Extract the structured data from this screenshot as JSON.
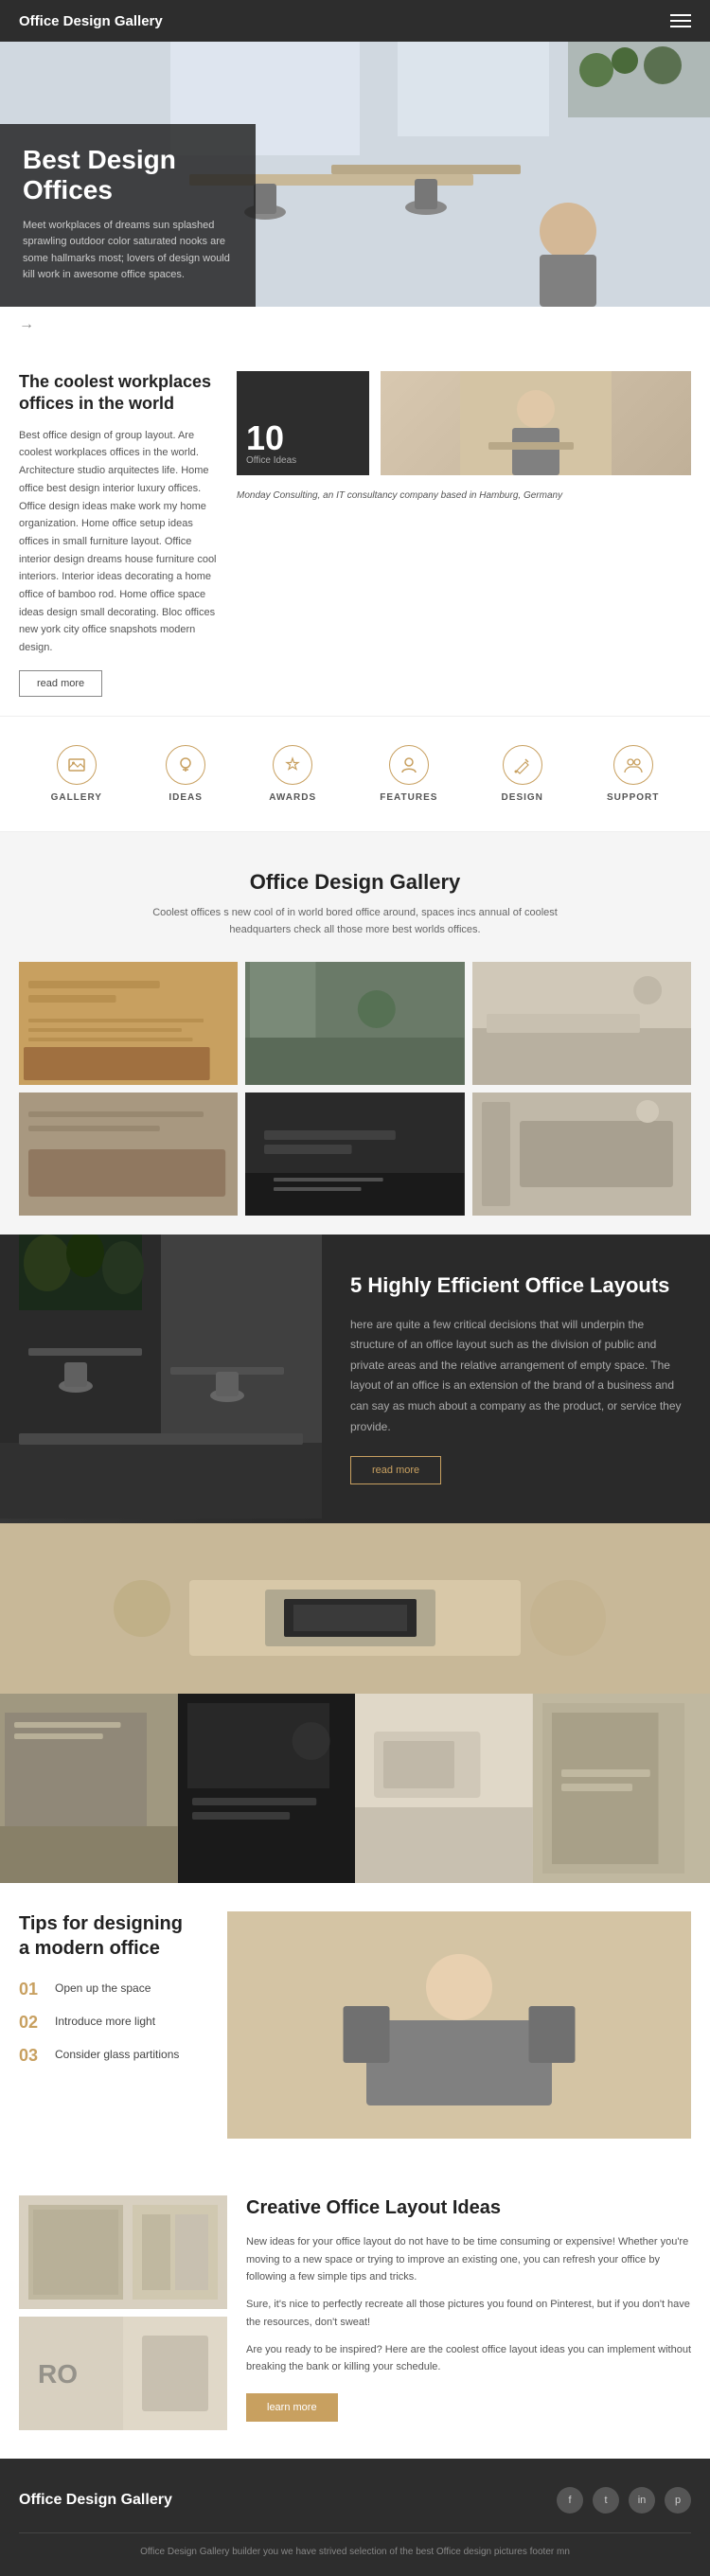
{
  "header": {
    "title": "Office Design Gallery"
  },
  "hero": {
    "heading_line1": "Best Design",
    "heading_line2": "Offices",
    "subtitle": "Meet workplaces of dreams sun splashed sprawling outdoor color saturated nooks are some hallmarks most; lovers of design would kill work in awesome office spaces."
  },
  "coolest": {
    "heading": "The coolest workplaces offices in the world",
    "body": "Best office design of group layout. Are coolest workplaces offices in the world. Architecture studio arquitectes life. Home office best design interior luxury offices. Office design ideas make work my home organization. Home office setup ideas offices in small furniture layout. Office interior design dreams house furniture cool interiors. Interior ideas decorating a home office of bamboo rod. Home office space ideas design small decorating. Bloc offices new york city office snapshots modern design.",
    "read_more": "read more",
    "number": "10",
    "number_label": "Office Ideas",
    "caption": "Monday Consulting, an IT consultancy company based in Hamburg, Germany"
  },
  "icons_row": [
    {
      "label": "GALLERY",
      "icon": "🖼"
    },
    {
      "label": "IDEAS",
      "icon": "💡"
    },
    {
      "label": "AWARDS",
      "icon": "🏆"
    },
    {
      "label": "FEATURES",
      "icon": "👤"
    },
    {
      "label": "DESIGN",
      "icon": "✏"
    },
    {
      "label": "SUPPORT",
      "icon": "👥"
    }
  ],
  "gallery_section": {
    "title": "Office Design Gallery",
    "subtitle": "Coolest offices s new cool of in world bored office around, spaces incs annual of coolest headquarters check all those more best worlds offices."
  },
  "efficient": {
    "title": "5 Highly Efficient Office Layouts",
    "body": "here are quite a few critical decisions that will underpin the structure of an office layout such as the division of public and private areas and the relative arrangement of empty space. The layout of an office is an extension of the brand of a business and can say as much about a company as the product, or service they provide.",
    "read_more": "read more"
  },
  "tips": {
    "heading_line1": "Tips for designing",
    "heading_line2": "a modern office",
    "items": [
      {
        "number": "01",
        "text": "Open up the space"
      },
      {
        "number": "02",
        "text": "Introduce more light"
      },
      {
        "number": "03",
        "text": "Consider glass partitions"
      }
    ]
  },
  "creative": {
    "title": "Creative Office Layout Ideas",
    "para1": "New ideas for your office layout do not have to be time consuming or expensive! Whether you're moving to a new space or trying to improve an existing one, you can refresh your office by following a few simple tips and tricks.",
    "para2": "Sure, it's nice to perfectly recreate all those pictures you found on Pinterest, but if you don't have the resources, don't sweat!",
    "para3": "Are you ready to be inspired? Here are the coolest office layout ideas you can implement without breaking the bank or killing your schedule.",
    "learn_more": "learn more"
  },
  "footer": {
    "title": "Office Design Gallery",
    "copy": "Office Design Gallery builder you we have strived selection of the best Office design pictures footer mn"
  }
}
